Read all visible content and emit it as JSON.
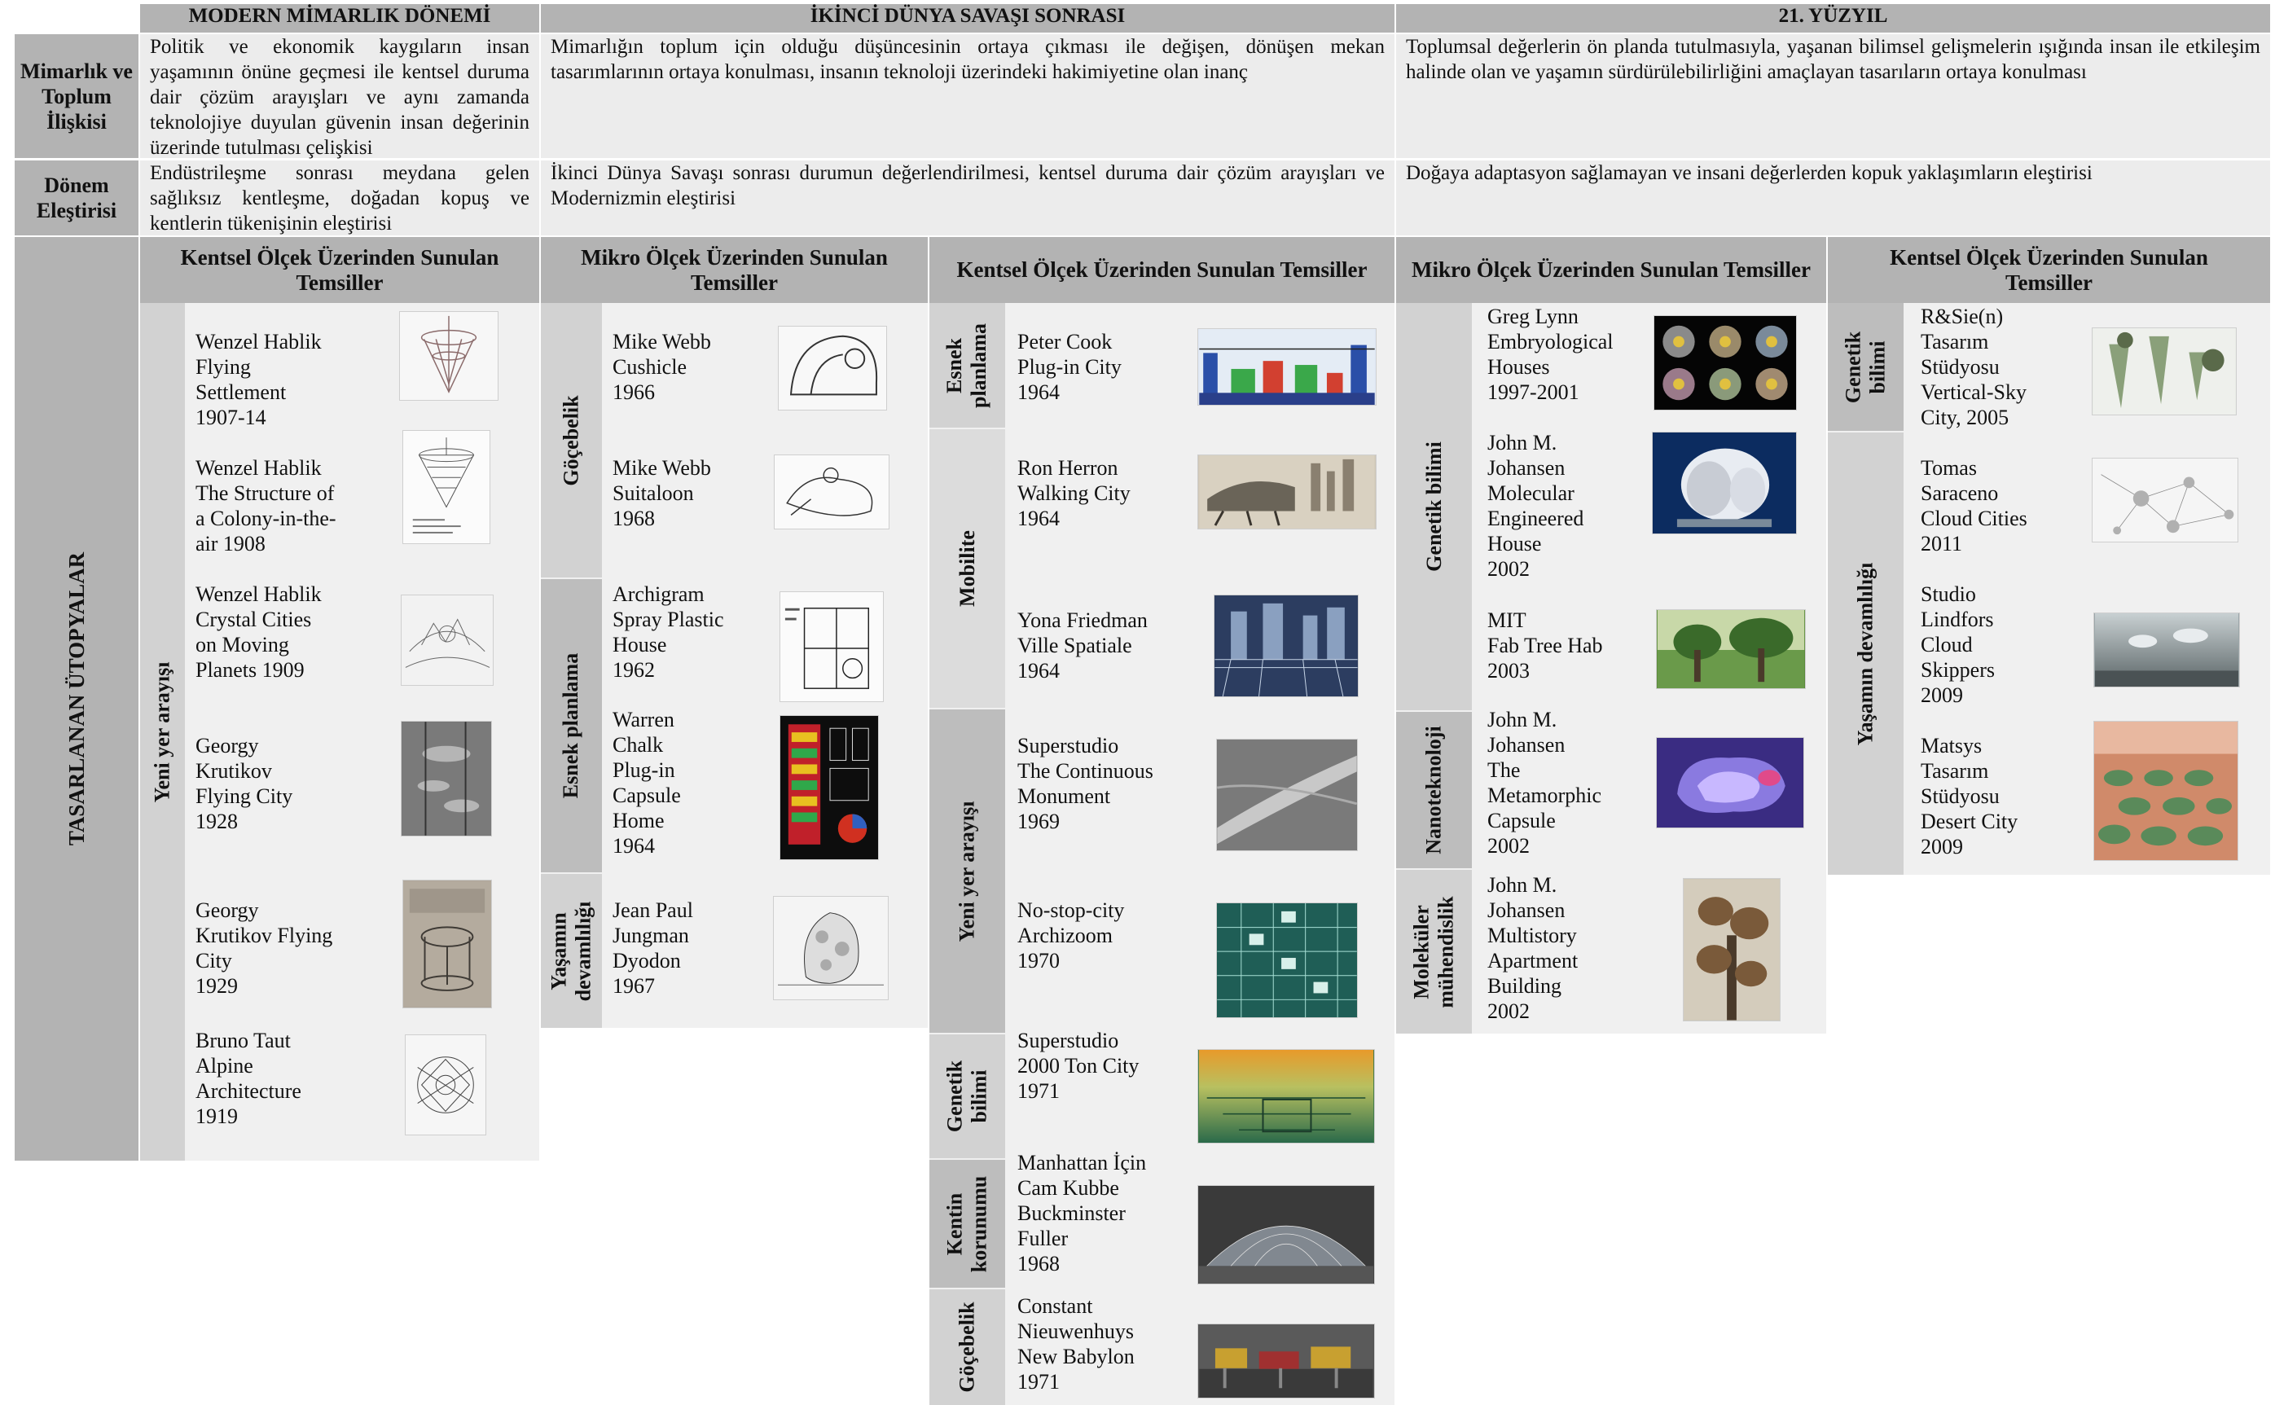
{
  "headers": {
    "modern": "MODERN MİMARLIK DÖNEMİ",
    "post_war": "İKİNCİ DÜNYA SAVAŞI SONRASI",
    "c21": "21. YÜZYIL"
  },
  "row_labels": {
    "relation": "Mimarlık ve Toplum İlişkisi",
    "critique": "Dönem Eleştirisi",
    "utopias": "TASARLANAN ÜTOPYALAR"
  },
  "relation": {
    "modern": "Politik ve ekonomik kaygıların insan yaşamının önüne geçmesi ile kentsel duruma dair çözüm arayışları ve aynı zamanda teknolojiye duyulan güvenin insan değerinin üzerinde tutulması çelişkisi",
    "post_war": "Mimarlığın toplum için olduğu düşüncesinin ortaya çıkması ile değişen, dönüşen mekan tasarımlarının ortaya konulması, insanın teknoloji üzerindeki hakimiyetine olan inanç",
    "c21": "Toplumsal değerlerin ön planda tutulmasıyla, yaşanan bilimsel gelişmelerin ışığında insan ile etkileşim halinde olan ve yaşamın sürdürülebilirliğini amaçlayan tasarıların ortaya konulması"
  },
  "critique": {
    "modern": "Endüstrileşme sonrası meydana gelen sağlıksız kentleşme, doğadan kopuş ve kentlerin tükenişinin eleştirisi",
    "post_war": "İkinci Dünya Savaşı sonrası durumun değerlendirilmesi, kentsel duruma dair çözüm arayışları ve Modernizmin eleştirisi",
    "c21": "Doğaya adaptasyon sağlamayan ve insani değerlerden kopuk yaklaşımların eleştirisi"
  },
  "subheaders": {
    "c1": "Kentsel Ölçek Üzerinden Sunulan Temsiller",
    "c2": "Mikro Ölçek Üzerinden Sunulan Temsiller",
    "c3": "Kentsel Ölçek Üzerinden Sunulan Temsiller",
    "c4": "Mikro Ölçek Üzerinden Sunulan Temsiller",
    "c5": "Kentsel Ölçek Üzerinden Sunulan Temsiller"
  },
  "categories": {
    "c1_yeni": "Yeni yer arayışı",
    "c2_gocebelik": "Göçebelik",
    "c2_esnek": "Esnek planlama",
    "c2_yasam": "Yaşamın devamlılığı",
    "c3_esnek": "Esnek planlama",
    "c3_mobilite": "Mobilite",
    "c3_yeni": "Yeni yer arayışı",
    "c3_genetik": "Genetik bilimi",
    "c3_kentin": "Kentin korunumu",
    "c3_gocebelik": "Göçebelik",
    "c4_genetik": "Genetik bilimi",
    "c4_nano": "Nanoteknoloji",
    "c4_molekul": "Moleküler mühendislik",
    "c5_genetik": "Genetik bilimi",
    "c5_yasam": "Yaşamın devamlılığı"
  },
  "items": {
    "c1_1": "Wenzel Hablik\nFlying\nSettlement\n1907-14",
    "c1_2": "Wenzel Hablik\nThe Structure of\na Colony-in-the-\nair 1908",
    "c1_3": "Wenzel Hablik\nCrystal Cities\non Moving\nPlanets 1909",
    "c1_4": "Georgy\nKrutikov\nFlying City\n1928",
    "c1_5": "Georgy\nKrutikov Flying\nCity\n1929",
    "c1_6": "Bruno Taut\nAlpine\nArchitecture\n1919",
    "c2_1": "Mike   Webb\nCushicle\n1966",
    "c2_2": "Mike Webb\nSuitaloon\n1968",
    "c2_3": "Archigram\nSpray Plastic\nHouse\n1962",
    "c2_4": "Warren\nChalk\nPlug-in\nCapsule\nHome\n1964",
    "c2_5": "Jean Paul\nJungman\nDyodon\n1967",
    "c3_1": "Peter Cook\nPlug-in City\n1964",
    "c3_2": "Ron Herron\nWalking City\n1964",
    "c3_3": "Yona Friedman\nVille Spatiale\n1964",
    "c3_4": "Superstudio\nThe  Continuous\nMonument\n1969",
    "c3_5": "No-stop-city\nArchizoom\n1970",
    "c3_6": "Superstudio\n2000 Ton City\n1971",
    "c3_7": "Manhattan    İçin\nCam Kubbe\nBuckminster\nFuller\n1968",
    "c3_8": "Constant\nNieuwenhuys\nNew Babylon\n1971",
    "c4_1": "Greg Lynn\nEmbryological\nHouses\n1997-2001",
    "c4_2": "John M.\nJohansen\nMolecular\nEngineered\nHouse\n2002",
    "c4_3": "MIT\nFab Tree Hab\n2003",
    "c4_4": "John M.\nJohansen\nThe\nMetamorphic\nCapsule\n2002",
    "c4_5": "John M.\nJohansen\nMultistory\nApartment\nBuilding\n2002",
    "c5_1": "R&Sie(n)\nTasarım\nStüdyosu\nVertical-Sky\nCity, 2005",
    "c5_2": "Tomas\nSaraceno\nCloud Cities\n2011",
    "c5_3": "Studio\nLindfors\nCloud\nSkippers\n2009",
    "c5_4": "Matsys\nTasarım\nStüdyosu\nDesert City\n2009"
  },
  "colors": {
    "header_gray": "#b3b3b3",
    "tab_gray": "#d2d2d2",
    "panel_light": "#f0f0f0"
  }
}
